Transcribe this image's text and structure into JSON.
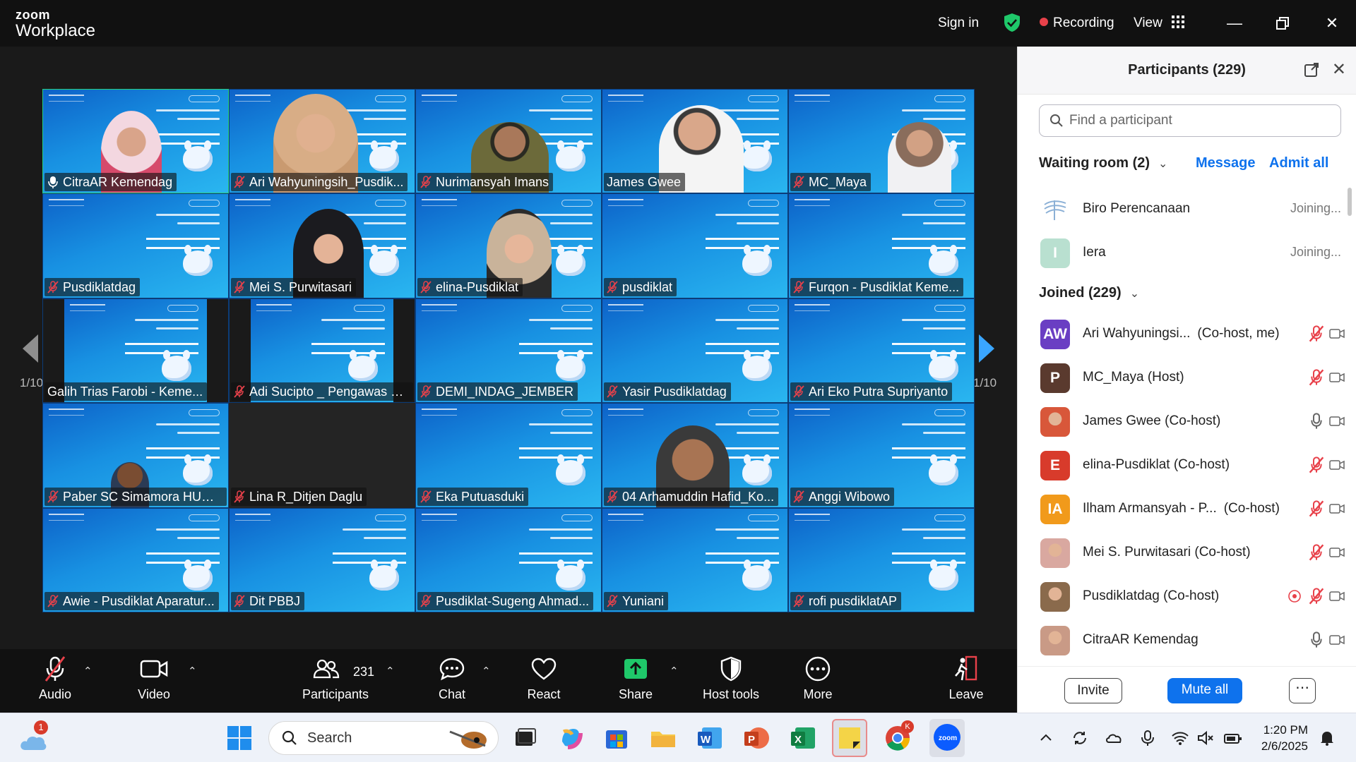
{
  "window": {
    "brand_top": "zoom",
    "brand_bottom": "Workplace",
    "sign_in": "Sign in",
    "recording": "Recording",
    "view": "View"
  },
  "grid": {
    "page_indicator_left": "1/10",
    "page_indicator_right": "1/10",
    "tiles": [
      {
        "name": "CitraAR Kemendag",
        "mic": "speaking",
        "active": true,
        "person": "hijab-pink"
      },
      {
        "name": "Ari Wahyuningsih_Pusdik...",
        "mic": "muted",
        "person": "hijab-beige"
      },
      {
        "name": "Nurimansyah Imans",
        "mic": "muted",
        "person": "man-batik"
      },
      {
        "name": "James Gwee",
        "mic": "none",
        "person": "man-white"
      },
      {
        "name": "MC_Maya",
        "mic": "muted",
        "person": "mc-studio"
      },
      {
        "name": "Pusdiklatdag",
        "mic": "muted"
      },
      {
        "name": "Mei S. Purwitasari",
        "mic": "muted",
        "person": "hijab-black"
      },
      {
        "name": "elina-Pusdiklat",
        "mic": "muted",
        "person": "hijab-beige2"
      },
      {
        "name": "pusdiklat",
        "mic": "muted"
      },
      {
        "name": "Furqon - Pusdiklat Keme...",
        "mic": "muted"
      },
      {
        "name": "Galih Trias Farobi - Keme...",
        "mic": "none",
        "narrow": true
      },
      {
        "name": "Adi Sucipto _ Pengawas K...",
        "mic": "muted",
        "narrow": true
      },
      {
        "name": "DEMI_INDAG_JEMBER",
        "mic": "muted"
      },
      {
        "name": "Yasir Pusdiklatdag",
        "mic": "muted"
      },
      {
        "name": "Ari Eko Putra Supriyanto",
        "mic": "muted"
      },
      {
        "name": "Paber SC Simamora HUM...",
        "mic": "muted",
        "person": "man-small"
      },
      {
        "name": "Lina R_Ditjen Daglu",
        "mic": "muted",
        "empty": true
      },
      {
        "name": "Eka Putuasduki",
        "mic": "muted"
      },
      {
        "name": "04 Arhamuddin Hafid_Ko...",
        "mic": "muted",
        "person": "man-face"
      },
      {
        "name": "Anggi Wibowo",
        "mic": "muted"
      },
      {
        "name": "Awie - Pusdiklat Aparatur...",
        "mic": "muted"
      },
      {
        "name": "Dit PBBJ",
        "mic": "muted"
      },
      {
        "name": "Pusdiklat-Sugeng Ahmad...",
        "mic": "muted"
      },
      {
        "name": "Yuniani",
        "mic": "muted"
      },
      {
        "name": "rofi pusdiklatAP",
        "mic": "muted"
      }
    ]
  },
  "toolbar": {
    "audio": "Audio",
    "video": "Video",
    "participants": "Participants",
    "participants_count": "231",
    "chat": "Chat",
    "react": "React",
    "share": "Share",
    "host_tools": "Host tools",
    "more": "More",
    "leave": "Leave"
  },
  "panel": {
    "title": "Participants (229)",
    "search_placeholder": "Find a participant",
    "waiting_room": "Waiting room (2)",
    "message": "Message",
    "admit_all": "Admit all",
    "waiting": [
      {
        "name": "Biro Perencanaan",
        "status": "Joining...",
        "avatar": "logo"
      },
      {
        "name": "Iera",
        "status": "Joining...",
        "initials": "I",
        "color": "#b9e0d0"
      }
    ],
    "joined": "Joined (229)",
    "participants": [
      {
        "name": "Ari Wahyuningsi...",
        "role": "(Co-host, me)",
        "initials": "AW",
        "color": "#6a3ec3",
        "mic": "muted"
      },
      {
        "name": "MC_Maya (Host)",
        "role": "",
        "initials": "P",
        "color": "#5a3a2e",
        "mic": "muted"
      },
      {
        "name": "James Gwee (Co-host)",
        "role": "",
        "initials": "",
        "color": "#d8573a",
        "mic": "on"
      },
      {
        "name": "elina-Pusdiklat (Co-host)",
        "role": "",
        "initials": "E",
        "color": "#d83b2b",
        "mic": "muted"
      },
      {
        "name": "Ilham Armansyah - P...",
        "role": "(Co-host)",
        "initials": "IA",
        "color": "#f19a1b",
        "mic": "muted"
      },
      {
        "name": "Mei S. Purwitasari (Co-host)",
        "role": "",
        "initials": "",
        "color": "#d9a8a0",
        "mic": "muted"
      },
      {
        "name": "Pusdiklatdag (Co-host)",
        "role": "",
        "initials": "",
        "color": "#8a6a4c",
        "mic": "muted",
        "recording": true
      },
      {
        "name": "CitraAR Kemendag",
        "role": "",
        "initials": "",
        "color": "#c99a86",
        "mic": "on"
      }
    ],
    "invite": "Invite",
    "mute_all": "Mute all"
  },
  "taskbar": {
    "search": "Search",
    "notification_count": "1",
    "chrome_badge": "K",
    "time": "1:20 PM",
    "date": "2/6/2025"
  },
  "colors": {
    "accent": "#0e72ed",
    "active_speaker": "#27d07c",
    "muted": "#e8414a",
    "share": "#1fc86a"
  }
}
